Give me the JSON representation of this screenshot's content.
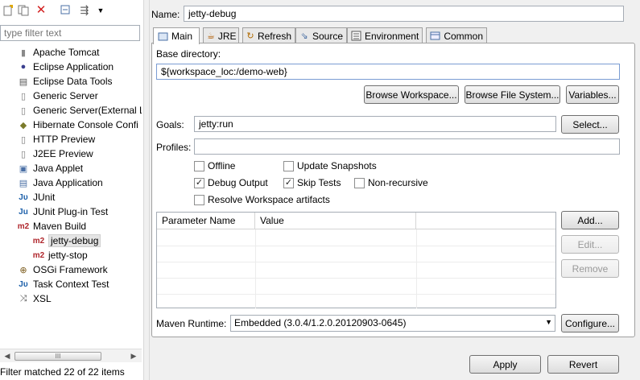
{
  "left_panel": {
    "toolbar_icons": [
      "new-config-icon",
      "duplicate-icon",
      "delete-icon",
      "collapse-all-icon",
      "filter-icon",
      "view-menu-icon"
    ],
    "filter_placeholder": "type filter text",
    "tree": [
      {
        "label": "Apache Tomcat",
        "icon": "tomcat-icon",
        "level": 0
      },
      {
        "label": "Eclipse Application",
        "icon": "eclipse-icon",
        "level": 0
      },
      {
        "label": "Eclipse Data Tools",
        "icon": "data-tools-icon",
        "level": 0
      },
      {
        "label": "Generic Server",
        "icon": "server-icon",
        "level": 0
      },
      {
        "label": "Generic Server(External La",
        "icon": "server-icon",
        "level": 0
      },
      {
        "label": "Hibernate Console Confi",
        "icon": "hibernate-icon",
        "level": 0
      },
      {
        "label": "HTTP Preview",
        "icon": "server-icon",
        "level": 0
      },
      {
        "label": "J2EE Preview",
        "icon": "server-icon",
        "level": 0
      },
      {
        "label": "Java Applet",
        "icon": "applet-icon",
        "level": 0
      },
      {
        "label": "Java Application",
        "icon": "java-app-icon",
        "level": 0
      },
      {
        "label": "JUnit",
        "icon": "junit-icon",
        "level": 0
      },
      {
        "label": "JUnit Plug-in Test",
        "icon": "junit-plugin-icon",
        "level": 0
      },
      {
        "label": "Maven Build",
        "icon": "maven-icon",
        "level": 0
      },
      {
        "label": "jetty-debug",
        "icon": "maven-icon",
        "level": 1,
        "selected": true
      },
      {
        "label": "jetty-stop",
        "icon": "maven-icon",
        "level": 1
      },
      {
        "label": "OSGi Framework",
        "icon": "osgi-icon",
        "level": 0
      },
      {
        "label": "Task Context Test",
        "icon": "junit-icon",
        "level": 0
      },
      {
        "label": "XSL",
        "icon": "xsl-icon",
        "level": 0
      }
    ],
    "scrollbar_grip": "III",
    "status_text": "Filter matched 22 of 22 items"
  },
  "config": {
    "name_label": "Name:",
    "name_value": "jetty-debug",
    "tabs": [
      {
        "label": "Main",
        "icon": "main-tab-icon",
        "active": true
      },
      {
        "label": "JRE",
        "icon": "jre-icon"
      },
      {
        "label": "Refresh",
        "icon": "refresh-icon"
      },
      {
        "label": "Source",
        "icon": "source-icon"
      },
      {
        "label": "Environment",
        "icon": "environment-icon"
      },
      {
        "label": "Common",
        "icon": "common-icon"
      }
    ],
    "base_dir_label": "Base directory:",
    "base_dir_value": "${workspace_loc:/demo-web}",
    "browse_workspace": "Browse Workspace...",
    "browse_filesystem": "Browse File System...",
    "variables": "Variables...",
    "goals_label": "Goals:",
    "goals_value": "jetty:run",
    "select_button": "Select...",
    "profiles_label": "Profiles:",
    "profiles_value": "",
    "checkboxes": {
      "offline": {
        "label": "Offline",
        "checked": false
      },
      "update_snapshots": {
        "label": "Update Snapshots",
        "checked": false
      },
      "debug_output": {
        "label": "Debug Output",
        "checked": true
      },
      "skip_tests": {
        "label": "Skip Tests",
        "checked": true
      },
      "non_recursive": {
        "label": "Non-recursive",
        "checked": false
      },
      "resolve_workspace": {
        "label": "Resolve Workspace artifacts",
        "checked": false
      }
    },
    "param_table": {
      "columns": [
        "Parameter Name",
        "Value"
      ],
      "rows": []
    },
    "add_button": "Add...",
    "edit_button": "Edit...",
    "remove_button": "Remove",
    "runtime_label": "Maven Runtime:",
    "runtime_value": "Embedded (3.0.4/1.2.0.20120903-0645)",
    "configure_button": "Configure...",
    "apply_button": "Apply",
    "revert_button": "Revert"
  },
  "colors": {
    "delete": "#d32020",
    "maven": "#b0272d",
    "selection": "#e5e5e5"
  }
}
